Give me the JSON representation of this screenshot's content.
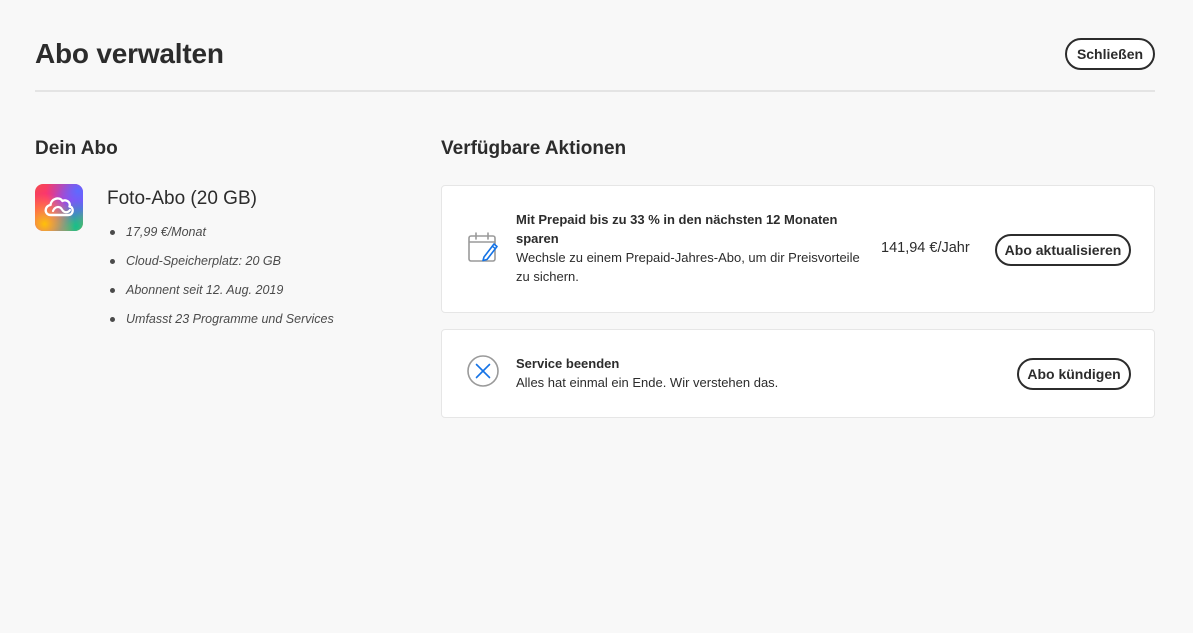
{
  "header": {
    "title": "Abo verwalten",
    "close_label": "Schließen"
  },
  "subscription": {
    "section_title": "Dein Abo",
    "app_icon": "creative-cloud-logo",
    "plan_name": "Foto-Abo (20 GB)",
    "details": [
      "17,99 €/Monat",
      "Cloud-Speicherplatz: 20 GB",
      "Abonnent seit 12. Aug. 2019",
      "Umfasst 23 Programme und Services"
    ]
  },
  "actions": {
    "section_title": "Verfügbare Aktionen",
    "prepaid": {
      "icon": "calendar-edit-icon",
      "heading": "Mit Prepaid bis zu 33 % in den nächsten 12 Monaten sparen",
      "description": "Wechsle zu einem Prepaid-Jahres-Abo, um dir Preisvorteile zu sichern.",
      "price": "141,94 €/Jahr",
      "button_label": "Abo aktualisieren"
    },
    "cancel": {
      "icon": "close-circle-icon",
      "heading": "Service beenden",
      "description": "Alles hat einmal ein Ende. Wir verstehen das.",
      "button_label": "Abo kündigen"
    }
  },
  "colors": {
    "background": "#f8f8f8",
    "card": "#ffffff",
    "text": "#2c2c2c",
    "accent_blue": "#1473e6",
    "icon_gray": "#9a9a9a"
  }
}
